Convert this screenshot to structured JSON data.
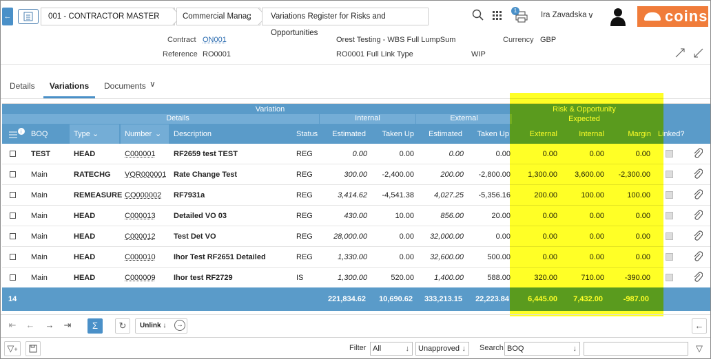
{
  "header": {
    "breadcrumbs": [
      "001 - CONTRACTOR MASTER",
      "Commercial Manager",
      "Variations Register for Risks and Opportunities"
    ],
    "notification_count": "1",
    "user_name": "Ira Zavadska",
    "logo_text": "coins"
  },
  "info": {
    "contract_label": "Contract",
    "contract_value": "ON001",
    "reference_label": "Reference",
    "reference_value": "RO0001",
    "title_line1": "Orest Testing - WBS Full LumpSum",
    "title_line2": "RO0001 Full Link Type",
    "currency_label": "Currency",
    "currency_value": "GBP",
    "status": "WIP"
  },
  "tabs": [
    {
      "label": "Details"
    },
    {
      "label": "Variations",
      "active": true
    },
    {
      "label": "Documents"
    }
  ],
  "grid": {
    "group_headers": {
      "variation": "Variation",
      "details": "Details",
      "internal": "Internal",
      "external": "External",
      "risk_line1": "Risk & Opportunity",
      "risk_line2": "Expected"
    },
    "columns": [
      "BOQ",
      "Type",
      "Number",
      "Description",
      "Status",
      "Estimated",
      "Taken Up",
      "Estimated",
      "Taken Up",
      "External",
      "Internal",
      "Margin",
      "Linked?"
    ],
    "rows": [
      {
        "boq": "TEST",
        "type": "HEAD",
        "number": "C000001",
        "description": "RF2659 test TEST",
        "status": "REG",
        "int_est": "0.00",
        "int_taken": "0.00",
        "ext_est": "0.00",
        "ext_taken": "0.00",
        "ro_ext": "0.00",
        "ro_int": "0.00",
        "ro_margin": "0.00"
      },
      {
        "boq": "Main",
        "type": "RATECHG",
        "number": "VOR000001",
        "description": "Rate Change Test",
        "status": "REG",
        "int_est": "300.00",
        "int_taken": "-2,400.00",
        "ext_est": "200.00",
        "ext_taken": "-2,800.00",
        "ro_ext": "1,300.00",
        "ro_int": "3,600.00",
        "ro_margin": "-2,300.00"
      },
      {
        "boq": "Main",
        "type": "REMEASURE",
        "number": "CO000002",
        "description": "RF7931a",
        "status": "REG",
        "int_est": "3,414.62",
        "int_taken": "-4,541.38",
        "ext_est": "4,027.25",
        "ext_taken": "-5,356.16",
        "ro_ext": "200.00",
        "ro_int": "100.00",
        "ro_margin": "100.00"
      },
      {
        "boq": "Main",
        "type": "HEAD",
        "number": "C000013",
        "description": "Detailed VO 03",
        "status": "REG",
        "int_est": "430.00",
        "int_taken": "10.00",
        "ext_est": "856.00",
        "ext_taken": "20.00",
        "ro_ext": "0.00",
        "ro_int": "0.00",
        "ro_margin": "0.00"
      },
      {
        "boq": "Main",
        "type": "HEAD",
        "number": "C000012",
        "description": "Test Det VO",
        "status": "REG",
        "int_est": "28,000.00",
        "int_taken": "0.00",
        "ext_est": "32,000.00",
        "ext_taken": "0.00",
        "ro_ext": "0.00",
        "ro_int": "0.00",
        "ro_margin": "0.00"
      },
      {
        "boq": "Main",
        "type": "HEAD",
        "number": "C000010",
        "description": "Ihor Test RF2651 Detailed",
        "status": "REG",
        "int_est": "1,330.00",
        "int_taken": "0.00",
        "ext_est": "32,600.00",
        "ext_taken": "500.00",
        "ro_ext": "0.00",
        "ro_int": "0.00",
        "ro_margin": "0.00"
      },
      {
        "boq": "Main",
        "type": "HEAD",
        "number": "C000009",
        "description": "Ihor test RF2729",
        "status": "IS",
        "int_est": "1,300.00",
        "int_taken": "520.00",
        "ext_est": "1,400.00",
        "ext_taken": "588.00",
        "ro_ext": "320.00",
        "ro_int": "710.00",
        "ro_margin": "-390.00"
      }
    ],
    "totals": {
      "count": "14",
      "int_est": "221,834.62",
      "int_taken": "10,690.62",
      "ext_est": "333,213.15",
      "ext_taken": "22,223.84",
      "ro_ext": "6,445.00",
      "ro_int": "7,432.00",
      "ro_margin": "-987.00"
    }
  },
  "toolbar": {
    "unlink_label": "Unlink"
  },
  "filters": {
    "filter_label": "Filter",
    "filter_value": "All",
    "status_value": "Unapproved",
    "search_label": "Search",
    "search_value": "BOQ",
    "search_text": ""
  },
  "colors": {
    "accent": "#5a9bc9",
    "highlight": "#ffff00",
    "logo": "#f07c3a"
  }
}
